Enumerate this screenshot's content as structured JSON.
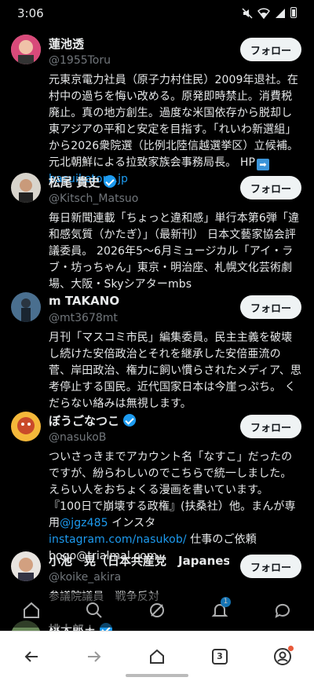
{
  "status": {
    "time": "3:06"
  },
  "users": [
    {
      "name": "蓮池透",
      "handle": "@1955Toru",
      "verified": false,
      "bio": "元東京電力社員（原子力村住民）2009年退社。在村中の過ちを悔い改める。原発即時禁止。消費税廃止。真の地方創生。過度な米国依存から脱却し東アジアの平和と安定を目指す。「れいわ新選組」から2026衆院選（比例北陸信越選挙区）立候補。元北朝鮮による拉致家族会事務局長。 HP",
      "link": "hasuiketoru.jp",
      "follow": "フォロー"
    },
    {
      "name": "松尾 貴史",
      "handle": "@Kitsch_Matsuo",
      "verified": true,
      "bio": "毎日新聞連載「ちょっと違和感」単行本第6弾「違和感気質（かたぎ）」（最新刊） 日本文藝家協会評議委員。 2026年5〜6月ミュージカル「アイ・ラブ・坊っちゃん」東京・明治座、札幌文化芸術劇場、大阪・Skyシアターmbs",
      "follow": "フォロー"
    },
    {
      "name": "m TAKANO",
      "handle": "@mt3678mt",
      "verified": false,
      "bio": "月刊「マスコミ市民」編集委員。民主主義を破壊し続けた安倍政治とそれを継承した安倍亜流の菅、岸田政治、権力に飼い慣らされたメディア、思考停止する国民。近代国家日本は今崖っぷち。 くだらない絡みは無視します。",
      "follow": "フォロー"
    },
    {
      "name": "ぼうごなつこ",
      "handle": "@nasukoB",
      "verified": true,
      "bio_part1": "ついさっきまでアカウント名「なすこ」だったのですが、紛らわしいのでこちらで統一しました。えらい人をおちょくる漫画を書いています。 『100日で崩壊する政権』(扶桑社）他。まんが専用",
      "mention": "@jgz485",
      "bio_part2": " インスタ",
      "insta_link": "instagram.com/nasukob/",
      "bio_part3": " 仕事のご依頼 bogo@trialmal.com",
      "follow": "フォロー"
    },
    {
      "name": "小池　晃（日本共産党　Japanese …",
      "handle": "@koike_akira",
      "verified": true,
      "bio": "参議院議員　戦争反対",
      "follow": "フォロー"
    },
    {
      "name": "桃太郎＋",
      "verified": true
    }
  ],
  "tabs": {
    "notifications_badge": "1"
  },
  "browser": {
    "tab_count": "3"
  },
  "colors": {
    "accent": "#1d9bf0",
    "background": "#000000",
    "muted": "#71767b"
  }
}
